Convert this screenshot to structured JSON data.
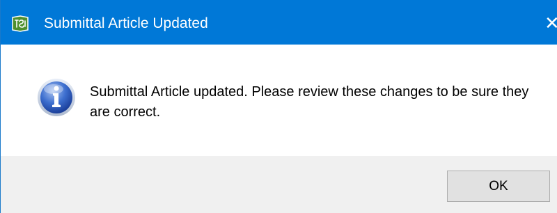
{
  "window": {
    "title": "Submittal Article Updated",
    "app_icon": "tsi-app-icon",
    "close_icon": "close-icon",
    "close_glyph": "✕",
    "titlebar_color": "#0078d7"
  },
  "message": {
    "icon": "info-icon",
    "text": "Submittal Article updated.  Please review these changes to be sure they are correct."
  },
  "buttons": {
    "ok_label": "OK"
  }
}
